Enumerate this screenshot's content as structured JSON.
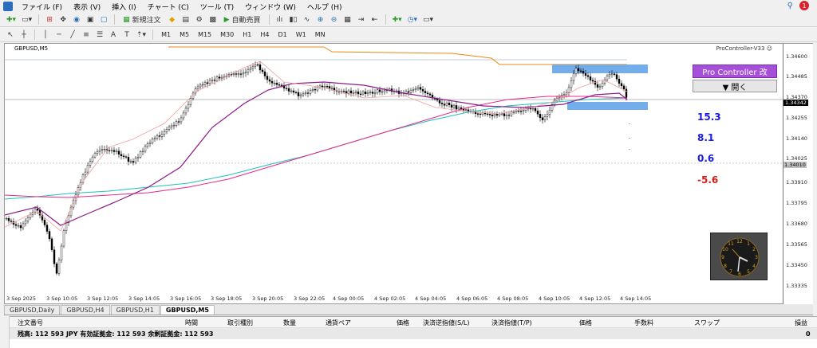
{
  "menu": {
    "items": [
      "ファイル (F)",
      "表示 (V)",
      "挿入 (I)",
      "チャート (C)",
      "ツール (T)",
      "ウィンドウ (W)",
      "ヘルプ (H)"
    ],
    "notification_count": "1"
  },
  "toolbar": {
    "new_order_label": "新規注文",
    "auto_trade_label": "自動売買"
  },
  "timeframes": [
    "M1",
    "M5",
    "M15",
    "M30",
    "H1",
    "H4",
    "D1",
    "W1",
    "MN"
  ],
  "chart": {
    "symbol_label": "GBPUSD,M5",
    "ea_label": "ProController-V33 ☺",
    "price_labels": [
      "1.34600",
      "1.34485",
      "1.34370",
      "1.34255",
      "1.34140",
      "1.34025",
      "1.33910",
      "1.33795",
      "1.33680",
      "1.33565",
      "1.33450",
      "1.33335"
    ],
    "current_price": "1.34342",
    "line_price": "1.34010",
    "time_labels": [
      "3 Sep 2025",
      "3 Sep 10:05",
      "3 Sep 12:05",
      "3 Sep 14:05",
      "3 Sep 16:05",
      "3 Sep 18:05",
      "3 Sep 20:05",
      "3 Sep 22:05",
      "4 Sep 00:05",
      "4 Sep 02:05",
      "4 Sep 04:05",
      "4 Sep 06:05",
      "4 Sep 08:05",
      "4 Sep 10:05",
      "4 Sep 12:05",
      "4 Sep 14:05"
    ]
  },
  "pro_controller": {
    "title": "Pro Controller 改",
    "open_label": "▼ 開く",
    "values": [
      "15.3",
      "8.1",
      "0.6",
      "-5.6"
    ]
  },
  "tabs": [
    "GBPUSD,Daily",
    "GBPUSD,H4",
    "GBPUSD,H1",
    "GBPUSD,M5"
  ],
  "active_tab": "GBPUSD,M5",
  "terminal": {
    "columns": [
      "注文番号",
      "時間",
      "取引種別",
      "数量",
      "通貨ペア",
      "価格",
      "決済逆指値(S/L)",
      "決済指値(T/P)",
      "価格",
      "手数料",
      "スワップ",
      "損益"
    ],
    "balance_text": "残高: 112 593 JPY  有効証拠金: 112 593  余剰証拠金: 112 593",
    "pl_value": "0"
  },
  "colors": {
    "ma_pink": "#e8288a",
    "ma_purple": "#8a1a8a",
    "ma_teal": "#1fbfbf",
    "ma_light": "#f0a0a0",
    "resistance": "#e88a10",
    "zone": "#5aa0e8",
    "pc_purple": "#a64fd8"
  }
}
